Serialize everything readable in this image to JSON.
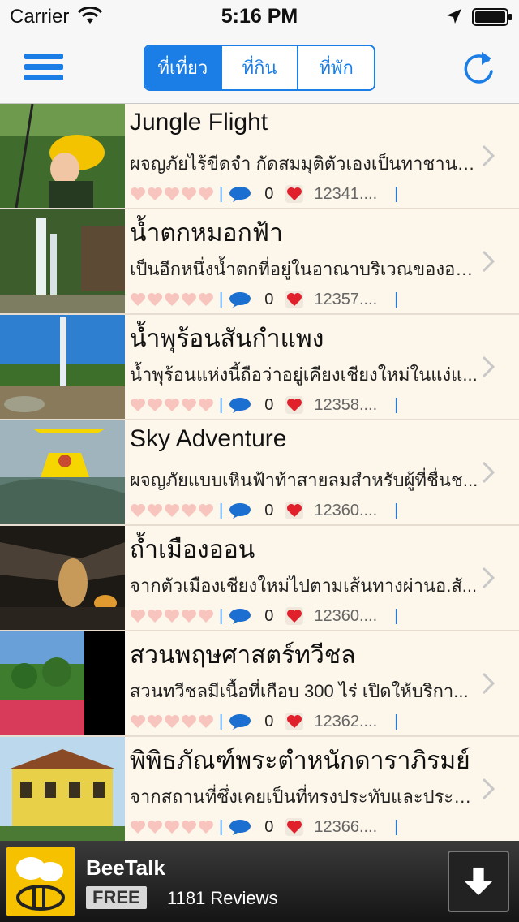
{
  "status_bar": {
    "carrier": "Carrier",
    "time": "5:16 PM"
  },
  "nav": {
    "tabs": [
      {
        "label": "ที่เที่ยว",
        "active": true
      },
      {
        "label": "ที่กิน",
        "active": false
      },
      {
        "label": "ที่พัก",
        "active": false
      }
    ]
  },
  "colors": {
    "accent": "#1a7ee6",
    "row_bg": "#fdf6ea",
    "heart_empty": "#f8c4be",
    "like": "#e0202a"
  },
  "rows": [
    {
      "title": "Jungle Flight",
      "desc": "ผจญภัยไร้ขีดจำ กัดสมมุติตัวเองเป็นทาชานแ...",
      "comments": "0",
      "views": "12341....",
      "rating": 0
    },
    {
      "title": "น้ำตกหมอกฟ้า",
      "desc": "เป็นอีกหนึ่งน้ำตกที่อยู่ในอาณาบริเวณของอช....",
      "comments": "0",
      "views": "12357....",
      "rating": 0
    },
    {
      "title": "น้ำพุร้อนสันกำแพง",
      "desc": "น้ำพุร้อนแห่งนี้ถือว่าอยู่เคียงเชียงใหม่ในแง่แ...",
      "comments": "0",
      "views": "12358....",
      "rating": 0
    },
    {
      "title": "Sky Adventure",
      "desc": "ผจญภัยแบบเหินฟ้าท้าสายลมสำหรับผู้ที่ชื่นช...",
      "comments": "0",
      "views": "12360....",
      "rating": 0
    },
    {
      "title": "ถ้ำเมืองออน",
      "desc": "จากตัวเมืองเชียงใหม่ไปตามเส้นทางผ่านอ.สั...",
      "comments": "0",
      "views": "12360....",
      "rating": 0
    },
    {
      "title": "สวนพฤษศาสตร์ทวีชล",
      "desc": "สวนทวีชลมีเนื้อที่เกือบ 300 ไร่ เปิดให้บริกา...",
      "comments": "0",
      "views": "12362....",
      "rating": 0
    },
    {
      "title": "พิพิธภัณฑ์พระตำหนักดาราภิรมย์",
      "desc": "จากสถานที่ซึ่งเคยเป็นที่ทรงประทับและประกอ...",
      "comments": "0",
      "views": "12366....",
      "rating": 0
    }
  ],
  "ad": {
    "title": "BeeTalk",
    "badge": "FREE",
    "reviews": "1181 Reviews"
  }
}
